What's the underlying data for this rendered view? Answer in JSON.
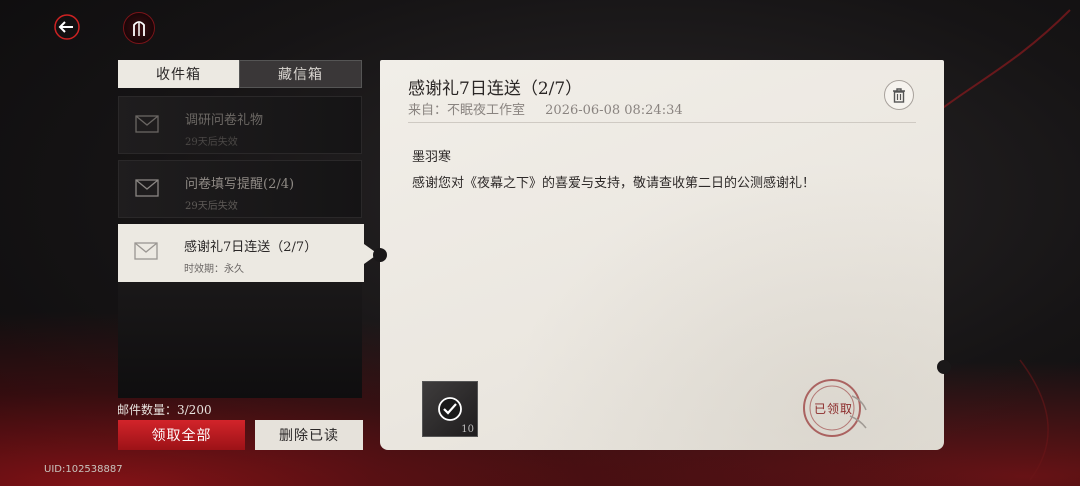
{
  "tabs": {
    "inbox": "收件箱",
    "saved": "藏信箱"
  },
  "mails": [
    {
      "title": "调研问卷礼物",
      "sub": "29天后失效"
    },
    {
      "title": "问卷填写提醒(2/4)",
      "sub": "29天后失效"
    },
    {
      "title": "感谢礼7日连送（2/7）",
      "sub": "时效期：永久"
    }
  ],
  "footer": {
    "mail_count": "邮件数量：3/200",
    "claim_all": "领取全部",
    "delete_read": "删除已读",
    "uid": "UID:102538887"
  },
  "letter": {
    "title": "感谢礼7日连送（2/7）",
    "from": "来自：不眠夜工作室",
    "date": "2026-06-08 08:24:34",
    "recipient": "墨羽寒",
    "body": "感谢您对《夜幕之下》的喜爱与支持，敬请查收第二日的公测感谢礼！",
    "reward_qty": "10",
    "stamp": "已领取"
  },
  "colors": {
    "accent": "#c41e24",
    "paper": "#ece9e2"
  }
}
